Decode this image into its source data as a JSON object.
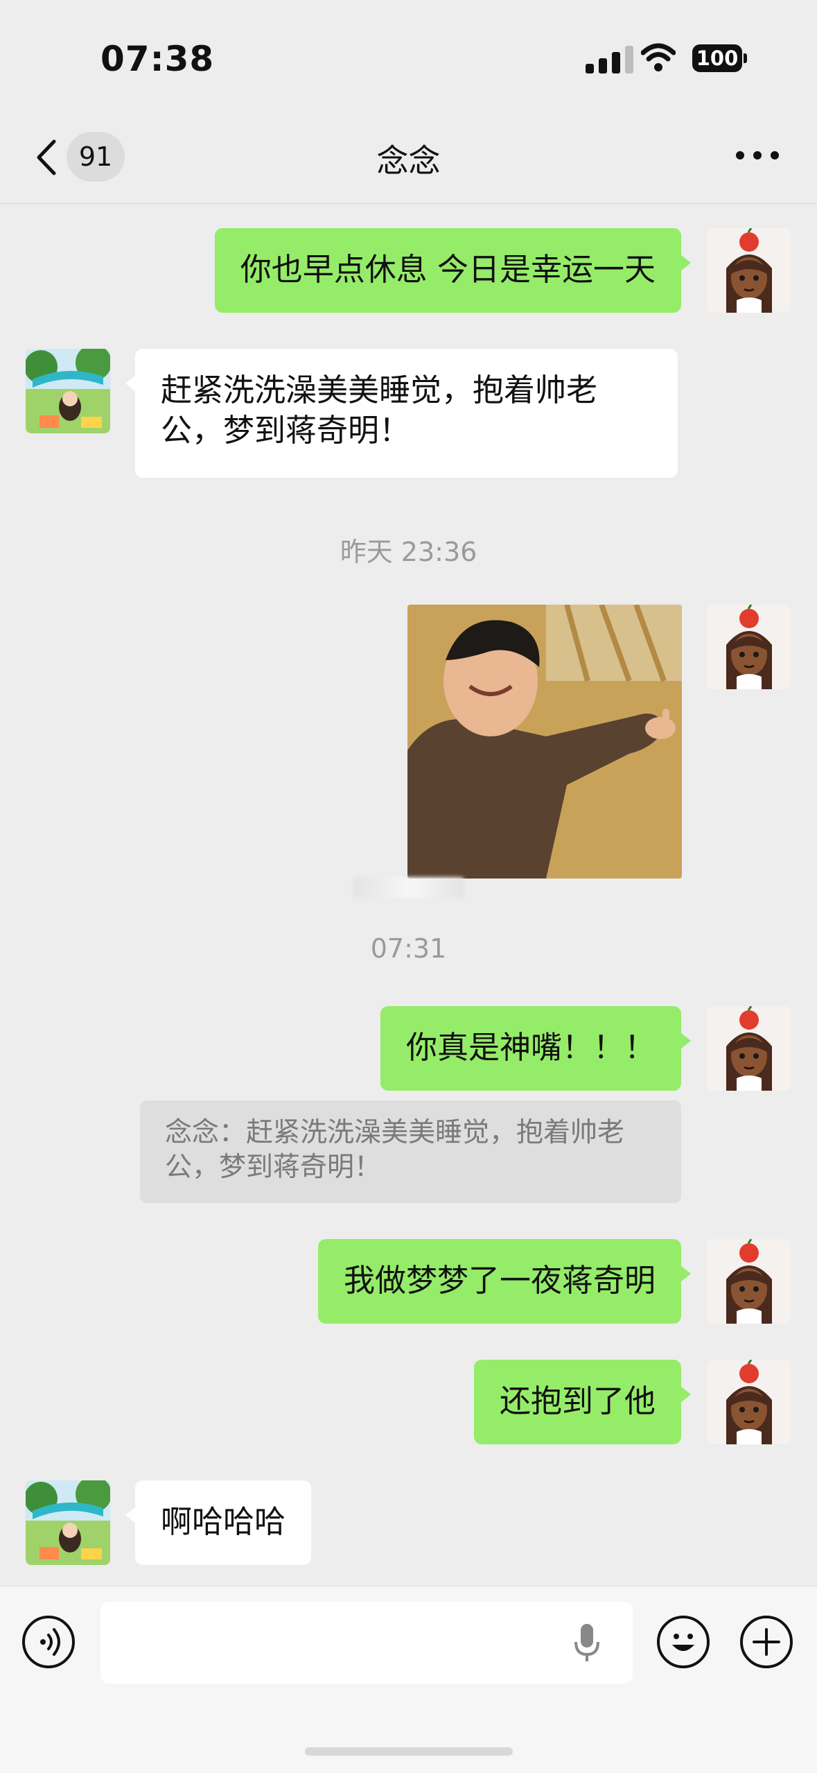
{
  "status_bar": {
    "time": "07:38",
    "battery": "100"
  },
  "nav": {
    "unread_count": "91",
    "title": "念念"
  },
  "messages": {
    "m1": "你也早点休息 今日是幸运一天",
    "m2_line1": "赶紧洗洗澡美美睡觉，抱着帅老",
    "m2_line2": "公，梦到蒋奇明！",
    "ts1": "昨天 23:36",
    "ts2": "07:31",
    "m3": "你真是神嘴！！！",
    "quote_line1": "念念：赶紧洗洗澡美美睡觉，抱着帅老",
    "quote_line2": "公，梦到蒋奇明！",
    "m4": "我做梦梦了一夜蒋奇明",
    "m5": "还抱到了他",
    "m6": "啊哈哈哈"
  },
  "colors": {
    "background": "#ededed",
    "my_bubble": "#95ec69",
    "other_bubble": "#ffffff",
    "quote_bg": "#dedede"
  },
  "icons": {
    "back": "chevron-left-icon",
    "more": "more-dots-icon",
    "voice": "voice-mode-icon",
    "mic": "microphone-icon",
    "emoji": "emoji-icon",
    "add": "plus-icon"
  }
}
